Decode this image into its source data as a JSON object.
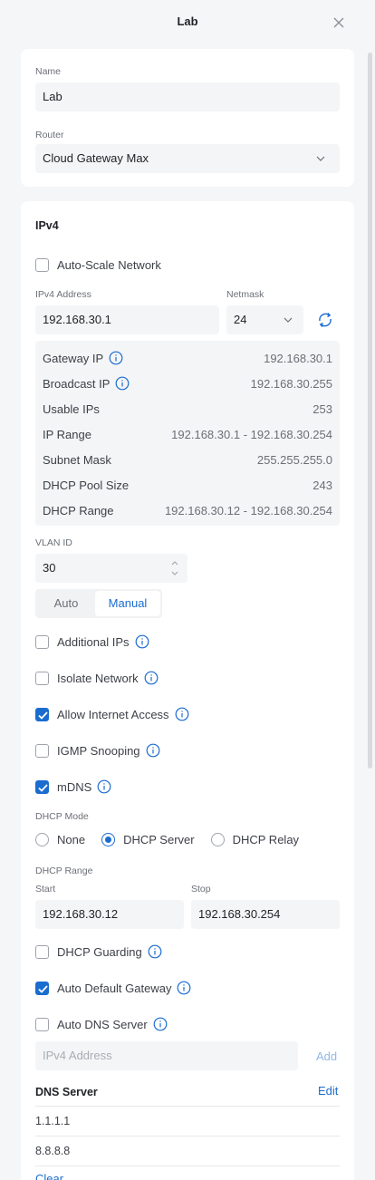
{
  "dialog": {
    "title": "Lab"
  },
  "general": {
    "name_label": "Name",
    "name_value": "Lab",
    "router_label": "Router",
    "router_value": "Cloud Gateway Max"
  },
  "ipv4": {
    "heading": "IPv4",
    "auto_scale_label": "Auto-Scale Network",
    "auto_scale_checked": false,
    "address_label": "IPv4 Address",
    "address_value": "192.168.30.1",
    "netmask_label": "Netmask",
    "netmask_value": "24",
    "stats": [
      {
        "label": "Gateway IP",
        "value": "192.168.30.1",
        "info": true
      },
      {
        "label": "Broadcast IP",
        "value": "192.168.30.255",
        "info": true
      },
      {
        "label": "Usable IPs",
        "value": "253",
        "info": false
      },
      {
        "label": "IP Range",
        "value": "192.168.30.1 - 192.168.30.254",
        "info": false
      },
      {
        "label": "Subnet Mask",
        "value": "255.255.255.0",
        "info": false
      },
      {
        "label": "DHCP Pool Size",
        "value": "243",
        "info": false
      },
      {
        "label": "DHCP Range",
        "value": "192.168.30.12 - 192.168.30.254",
        "info": false
      }
    ]
  },
  "vlan": {
    "label": "VLAN ID",
    "value": "30",
    "mode_auto": "Auto",
    "mode_manual": "Manual",
    "selected": "Manual"
  },
  "options": {
    "additional_ips": {
      "label": "Additional IPs",
      "checked": false
    },
    "isolate_network": {
      "label": "Isolate Network",
      "checked": false
    },
    "allow_internet": {
      "label": "Allow Internet Access",
      "checked": true
    },
    "igmp_snooping": {
      "label": "IGMP Snooping",
      "checked": false
    },
    "mdns": {
      "label": "mDNS",
      "checked": true
    }
  },
  "dhcp": {
    "mode_label": "DHCP Mode",
    "modes": [
      "None",
      "DHCP Server",
      "DHCP Relay"
    ],
    "selected_mode": "DHCP Server",
    "range_label": "DHCP Range",
    "start_label": "Start",
    "start_value": "192.168.30.12",
    "stop_label": "Stop",
    "stop_value": "192.168.30.254",
    "guarding": {
      "label": "DHCP Guarding",
      "checked": false
    },
    "auto_gateway": {
      "label": "Auto Default Gateway",
      "checked": true
    },
    "auto_dns": {
      "label": "Auto DNS Server",
      "checked": false
    },
    "dns_input_placeholder": "IPv4 Address",
    "add_label": "Add",
    "dns_server_title": "DNS Server",
    "edit_label": "Edit",
    "dns_servers": [
      "1.1.1.1",
      "8.8.8.8"
    ],
    "clear_label": "Clear"
  },
  "colors": {
    "accent": "#1b6ccf",
    "background": "#f5f6f7",
    "card": "#ffffff",
    "field": "#f4f5f6"
  },
  "icons": {
    "close": "close-icon",
    "chevron": "chevron-down-icon",
    "refresh": "refresh-icon",
    "info": "info-icon",
    "check": "check-icon"
  }
}
